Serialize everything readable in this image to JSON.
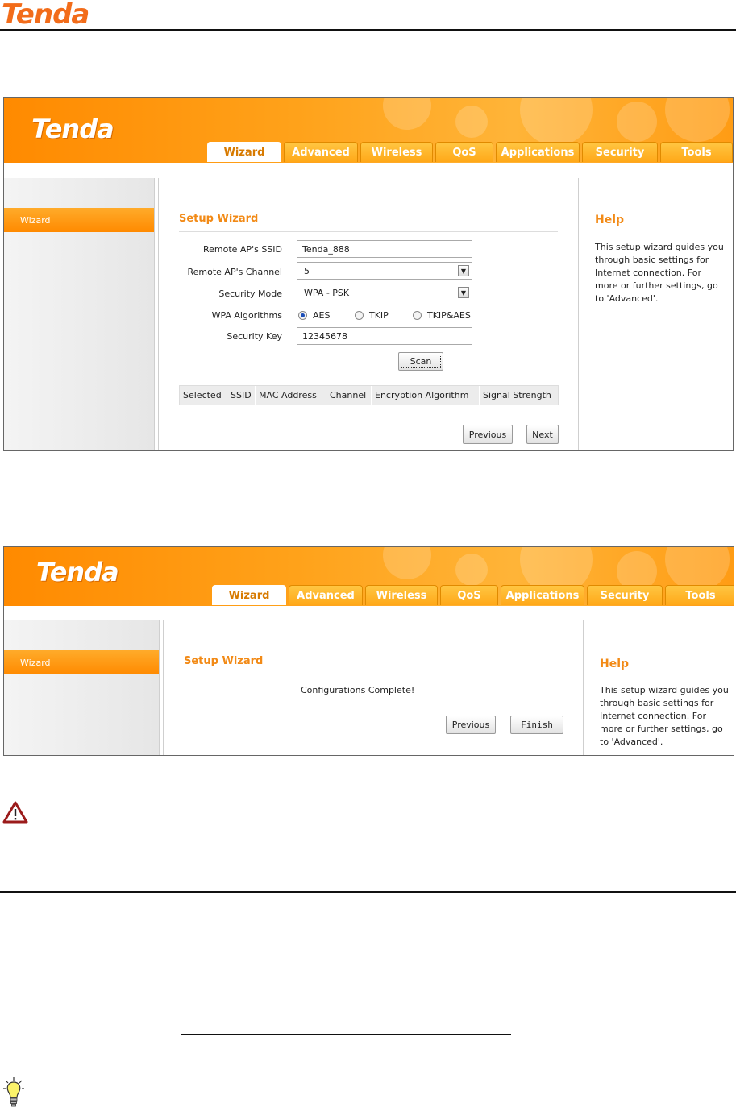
{
  "doc": {
    "logo": "Tenda"
  },
  "screen1": {
    "logo": "Tenda",
    "tabs": [
      "Wizard",
      "Advanced",
      "Wireless",
      "QoS",
      "Applications",
      "Security",
      "Tools"
    ],
    "sidebar_item": "Wizard",
    "section_title": "Setup Wizard",
    "fields": {
      "ssid_label": "Remote AP's SSID",
      "ssid_value": "Tenda_888",
      "channel_label": "Remote AP's Channel",
      "channel_value": "5",
      "mode_label": "Security Mode",
      "mode_value": "WPA - PSK",
      "alg_label": "WPA Algorithms",
      "alg_options": [
        "AES",
        "TKIP",
        "TKIP&AES"
      ],
      "alg_selected": "AES",
      "key_label": "Security Key",
      "key_value": "12345678"
    },
    "scan_button": "Scan",
    "table_headers": [
      "Selected",
      "SSID",
      "MAC Address",
      "Channel",
      "Encryption Algorithm",
      "Signal Strength"
    ],
    "prev_button": "Previous",
    "next_button": "Next",
    "help_title": "Help",
    "help_text": "This setup wizard guides you through basic settings for Internet connection. For more or further settings, go to 'Advanced'."
  },
  "screen2": {
    "logo": "Tenda",
    "tabs": [
      "Wizard",
      "Advanced",
      "Wireless",
      "QoS",
      "Applications",
      "Security",
      "Tools"
    ],
    "sidebar_item": "Wizard",
    "section_title": "Setup Wizard",
    "message": "Configurations Complete!",
    "prev_button": "Previous",
    "finish_button": "Finish",
    "help_title": "Help",
    "help_text": "This setup wizard guides you through basic settings for Internet connection. For more or further settings, go to 'Advanced'."
  },
  "icons": {
    "warning": "warning-triangle-icon",
    "tip": "lightbulb-icon"
  },
  "colors": {
    "brand_orange": "#ff9a10",
    "title_orange": "#f28a16"
  }
}
